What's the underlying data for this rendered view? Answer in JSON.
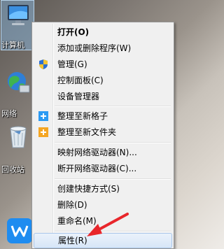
{
  "desktop": {
    "icons": [
      {
        "label": "计算机",
        "icon": "computer-icon"
      },
      {
        "label": "网络",
        "icon": "network-globe-icon"
      },
      {
        "label": "回收站",
        "icon": "recycle-bin-icon"
      },
      {
        "label": "",
        "icon": "app-w-icon"
      }
    ]
  },
  "context_menu": {
    "items": [
      {
        "label": "打开(O)",
        "bold": true
      },
      {
        "label": "添加或删除程序(W)"
      },
      {
        "label": "管理(G)",
        "icon": "shield-icon"
      },
      {
        "label": "控制面板(C)"
      },
      {
        "label": "设备管理器"
      },
      {
        "label": "整理至新格子",
        "icon": "plus-blue-icon"
      },
      {
        "label": "整理至新文件夹",
        "icon": "plus-orange-icon"
      },
      {
        "label": "映射网络驱动器(N)..."
      },
      {
        "label": "断开网络驱动器(C)..."
      },
      {
        "label": "创建快捷方式(S)"
      },
      {
        "label": "删除(D)"
      },
      {
        "label": "重命名(M)"
      },
      {
        "label": "属性(R)",
        "highlighted": true
      }
    ]
  },
  "colors": {
    "menu_bg": "#f0f0f0",
    "highlight": "#d7e6f7",
    "arrow": "#e8262b"
  }
}
